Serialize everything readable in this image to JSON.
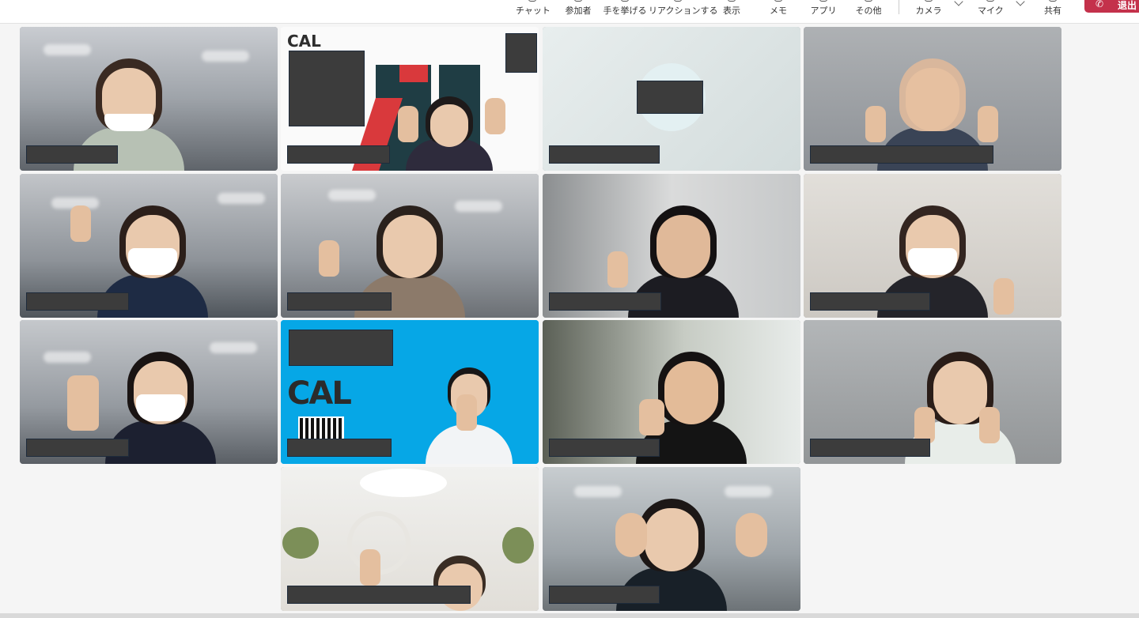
{
  "toolbar": {
    "items": [
      {
        "label": "チャット",
        "icon": "chat-icon"
      },
      {
        "label": "参加者",
        "icon": "people-icon"
      },
      {
        "label": "手を挙げる",
        "icon": "hand-icon"
      },
      {
        "label": "リアクションする",
        "icon": "reaction-icon"
      },
      {
        "label": "表示",
        "icon": "view-icon"
      },
      {
        "label": "メモ",
        "icon": "notes-icon"
      },
      {
        "label": "アプリ",
        "icon": "apps-icon"
      },
      {
        "label": "その他",
        "icon": "more-icon"
      },
      {
        "label": "カメラ",
        "icon": "camera-icon"
      },
      {
        "label": "マイク",
        "icon": "mic-icon"
      },
      {
        "label": "共有",
        "icon": "share-icon"
      }
    ],
    "leave_label": "退出"
  },
  "background_logos": {
    "tile2": "CAL",
    "tile10": "CAL"
  },
  "colors": {
    "toolbar_bg": "#ffffff",
    "stage_bg": "#f5f5f5",
    "leave_button": "#c4314b",
    "redaction": "#3c3c3c",
    "blue_background": "#00a7e8"
  }
}
